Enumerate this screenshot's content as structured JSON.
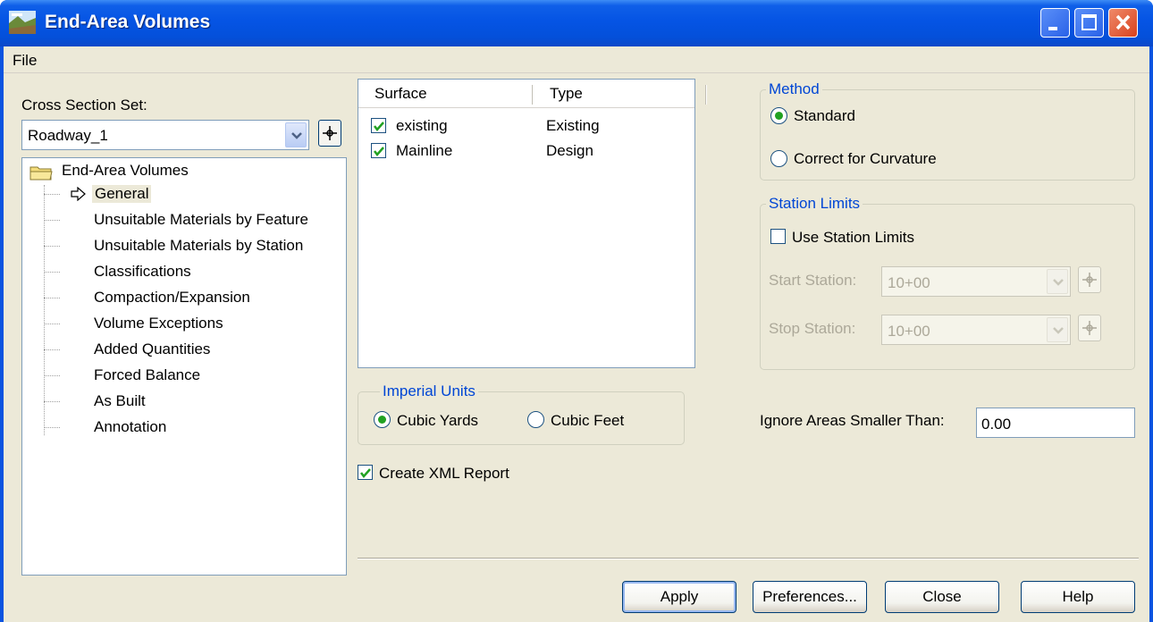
{
  "window": {
    "title": "End-Area Volumes"
  },
  "menu": {
    "file": "File"
  },
  "left": {
    "cross_section_label": "Cross Section Set:",
    "cross_section_value": "Roadway_1",
    "tree_root": "End-Area Volumes",
    "tree_items": [
      "General",
      "Unsuitable Materials by Feature",
      "Unsuitable Materials by Station",
      "Classifications",
      "Compaction/Expansion",
      "Volume Exceptions",
      "Added Quantities",
      "Forced Balance",
      "As Built",
      "Annotation"
    ],
    "selected_item": "General"
  },
  "surfaces": {
    "columns": [
      "Surface",
      "Type"
    ],
    "rows": [
      {
        "name": "existing",
        "type": "Existing",
        "checked": true
      },
      {
        "name": "Mainline",
        "type": "Design",
        "checked": true
      }
    ]
  },
  "units": {
    "group_title": "Imperial Units",
    "options": [
      "Cubic Yards",
      "Cubic Feet"
    ],
    "selected": "Cubic Yards"
  },
  "xml_report": {
    "label": "Create XML Report",
    "checked": true
  },
  "method": {
    "group_title": "Method",
    "options": [
      "Standard",
      "Correct for Curvature"
    ],
    "selected": "Standard"
  },
  "station_limits": {
    "group_title": "Station Limits",
    "use_label": "Use Station Limits",
    "use_checked": false,
    "start_label": "Start Station:",
    "start_value": "10+00",
    "stop_label": "Stop Station:",
    "stop_value": "10+00"
  },
  "ignore": {
    "label": "Ignore Areas Smaller Than:",
    "value": "0.00"
  },
  "buttons": {
    "apply": "Apply",
    "preferences": "Preferences...",
    "close": "Close",
    "help": "Help"
  },
  "colors": {
    "title_bar": "#0554e4",
    "dialog_bg": "#ece9d8",
    "group_title": "#0046d5",
    "radio_dot": "#21a121"
  }
}
